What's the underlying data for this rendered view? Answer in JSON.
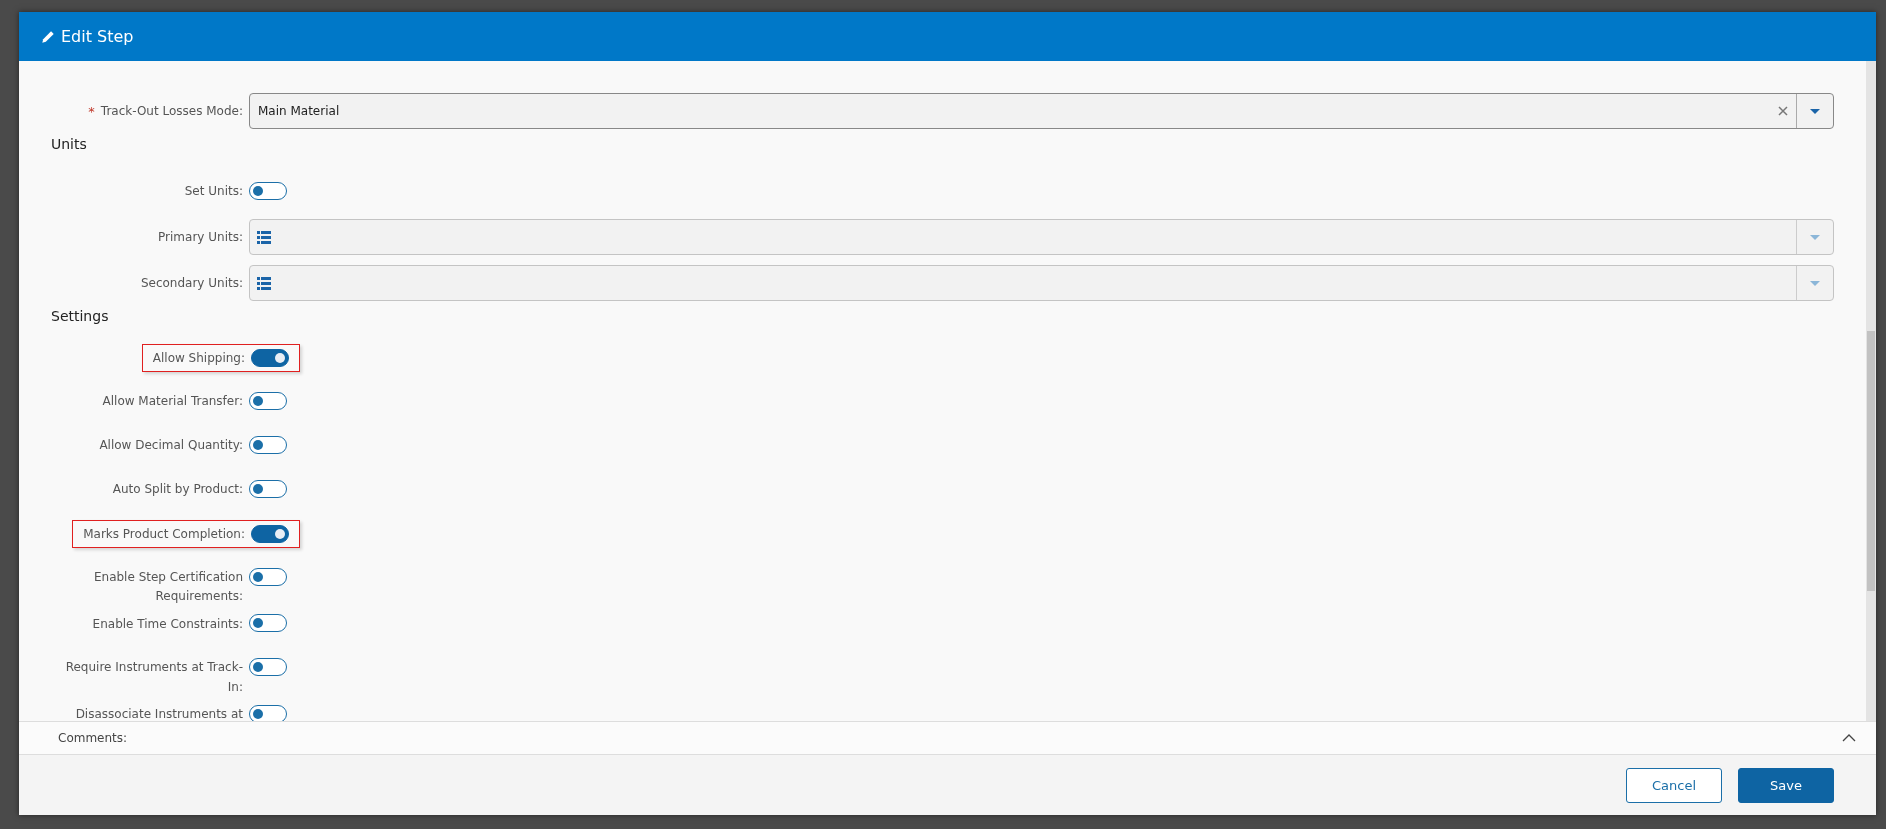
{
  "dialog": {
    "title": "Edit Step"
  },
  "track_out": {
    "label": "Track-Out Losses Mode:",
    "required": true,
    "required_mark": "*",
    "value": "Main Material"
  },
  "units": {
    "heading": "Units",
    "set_units": {
      "label": "Set Units:",
      "on": false
    },
    "fields": [
      {
        "label": "Primary Units:"
      },
      {
        "label": "Secondary Units:"
      }
    ]
  },
  "settings": {
    "heading": "Settings",
    "items": [
      {
        "label": "Allow Shipping:",
        "on": true,
        "highlighted": true
      },
      {
        "label": "Allow Material Transfer:",
        "on": false,
        "highlighted": false
      },
      {
        "label": "Allow Decimal Quantity:",
        "on": false,
        "highlighted": false
      },
      {
        "label": "Auto Split by Product:",
        "on": false,
        "highlighted": false
      },
      {
        "label": "Marks Product Completion:",
        "on": true,
        "highlighted": true
      },
      {
        "label": "Enable Step Certification Requirements:",
        "on": false,
        "highlighted": false
      },
      {
        "label": "Enable Time Constraints:",
        "on": false,
        "highlighted": false
      },
      {
        "label": "Require Instruments at Track-In:",
        "on": false,
        "highlighted": false
      },
      {
        "label": "Disassociate Instruments at",
        "on": false,
        "highlighted": false
      }
    ]
  },
  "comments": {
    "label": "Comments:",
    "expanded": false
  },
  "buttons": [
    {
      "label": "Cancel",
      "kind": "secondary"
    },
    {
      "label": "Save",
      "kind": "primary"
    }
  ]
}
